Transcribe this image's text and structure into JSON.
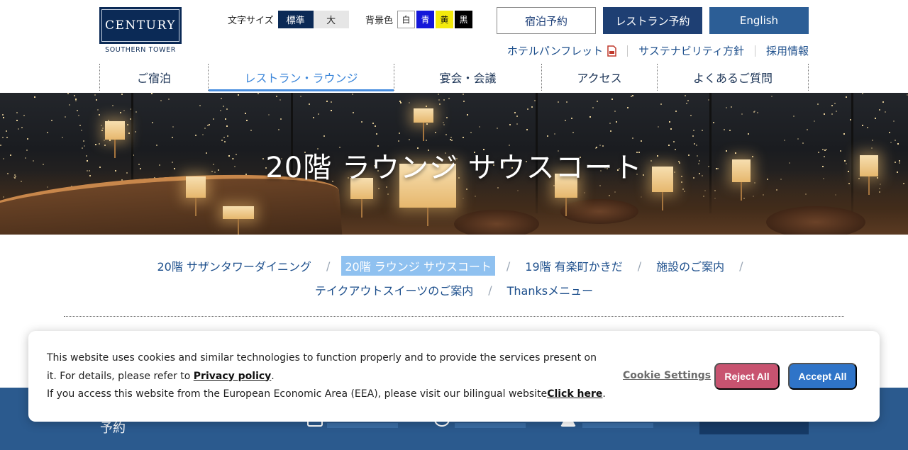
{
  "header": {
    "logo": {
      "name": "CENTURY",
      "sub": "SOUTHERN TOWER"
    },
    "font_size": {
      "label": "文字サイズ",
      "options": [
        "標準",
        "大"
      ]
    },
    "bg_color": {
      "label": "背景色",
      "options": [
        "白",
        "青",
        "黄",
        "黒"
      ]
    },
    "buttons": {
      "stay": "宿泊予約",
      "restaurant": "レストラン予約",
      "english": "English"
    },
    "util_links": [
      "ホテルパンフレット",
      "サステナビリティ方針",
      "採用情報"
    ],
    "gnav": [
      "ご宿泊",
      "レストラン・ラウンジ",
      "宴会・会議",
      "アクセス",
      "よくあるご質問"
    ],
    "gnav_active": 1
  },
  "hero": {
    "title": "20階 ラウンジ サウスコート"
  },
  "local_nav": {
    "row1": [
      "20階 サザンタワーダイニング",
      "20階 ラウンジ サウスコート",
      "19階 有楽町かきだ",
      "施設のご案内"
    ],
    "row2": [
      "テイクアウトスイーツのご案内",
      "Thanksメニュー"
    ],
    "active": "20階 ラウンジ サウスコート"
  },
  "bottombar": {
    "label": "予約"
  },
  "cookie": {
    "line1_a": "This website uses cookies and similar technologies to function properly and to provide the services present on it. For details, please refer to ",
    "line1_link": "Privacy policy",
    "line1_end": ".",
    "line2_a": "If you access this website from the European Economic Area (EEA), please visit our bilingual website",
    "line2_link": "Click here",
    "line2_end": ".",
    "settings": "Cookie Settings",
    "reject": "Reject All",
    "accept": "Accept All"
  },
  "colors": {
    "brand_navy": "#0b2a56",
    "link_blue": "#1d4f8c",
    "active_tab": "#4a8fdf",
    "reject": "#c85370",
    "accept": "#2f74c8",
    "footer_bar": "#2b5a8e"
  }
}
